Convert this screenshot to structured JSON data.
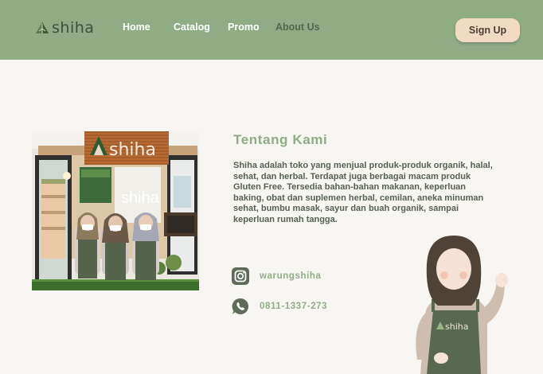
{
  "brand": {
    "name": "shiha"
  },
  "nav": {
    "home": "Home",
    "catalog": "Catalog",
    "promo": "Promo",
    "about": "About Us"
  },
  "signup_label": "Sign Up",
  "photo": {
    "sign_text": "shiha",
    "window_text": "shiha"
  },
  "about": {
    "title": "Tentang Kami",
    "body": "Shiha adalah toko yang menjual produk-produk organik, halal, sehat, dan herbal. Terdapat juga berbagai macam produk Gluten Free. Tersedia bahan-bahan makanan, keperluan baking, obat dan suplemen herbal, cemilan, aneka minuman sehat, bumbu masak, sayur dan buah organik, sampai keperluan rumah tangga."
  },
  "contacts": {
    "instagram": {
      "icon": "instagram-icon",
      "handle": "warungshiha"
    },
    "whatsapp": {
      "icon": "whatsapp-icon",
      "phone": "0811-1337-273"
    }
  },
  "illustration": {
    "apron_text": "shiha"
  },
  "colors": {
    "primary": "#8fac85",
    "accent": "#f1dbc3",
    "background": "#f8f6f3"
  }
}
